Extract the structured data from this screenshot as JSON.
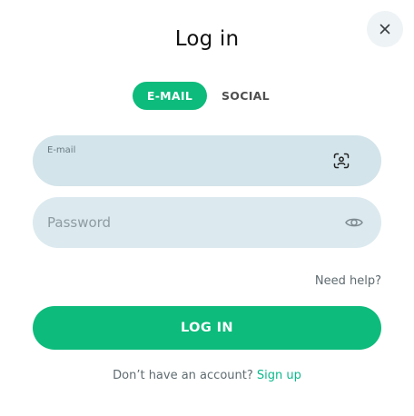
{
  "dialog": {
    "title": "Log in",
    "close_icon": "close-icon"
  },
  "tabs": [
    {
      "label": "E-MAIL",
      "active": true
    },
    {
      "label": "SOCIAL",
      "active": false
    }
  ],
  "form": {
    "email": {
      "label": "E-mail",
      "value": "",
      "icon": "face-scan-icon"
    },
    "password": {
      "placeholder": "Password",
      "value": "",
      "icon": "eye-icon"
    },
    "need_help": "Need help?",
    "submit_label": "LOG IN"
  },
  "footer": {
    "prompt": "Don’t have an account?",
    "signup_link": "Sign up"
  },
  "colors": {
    "accent": "#0dbb7c",
    "field_bg": "#dceaef",
    "link": "#0db88c"
  }
}
